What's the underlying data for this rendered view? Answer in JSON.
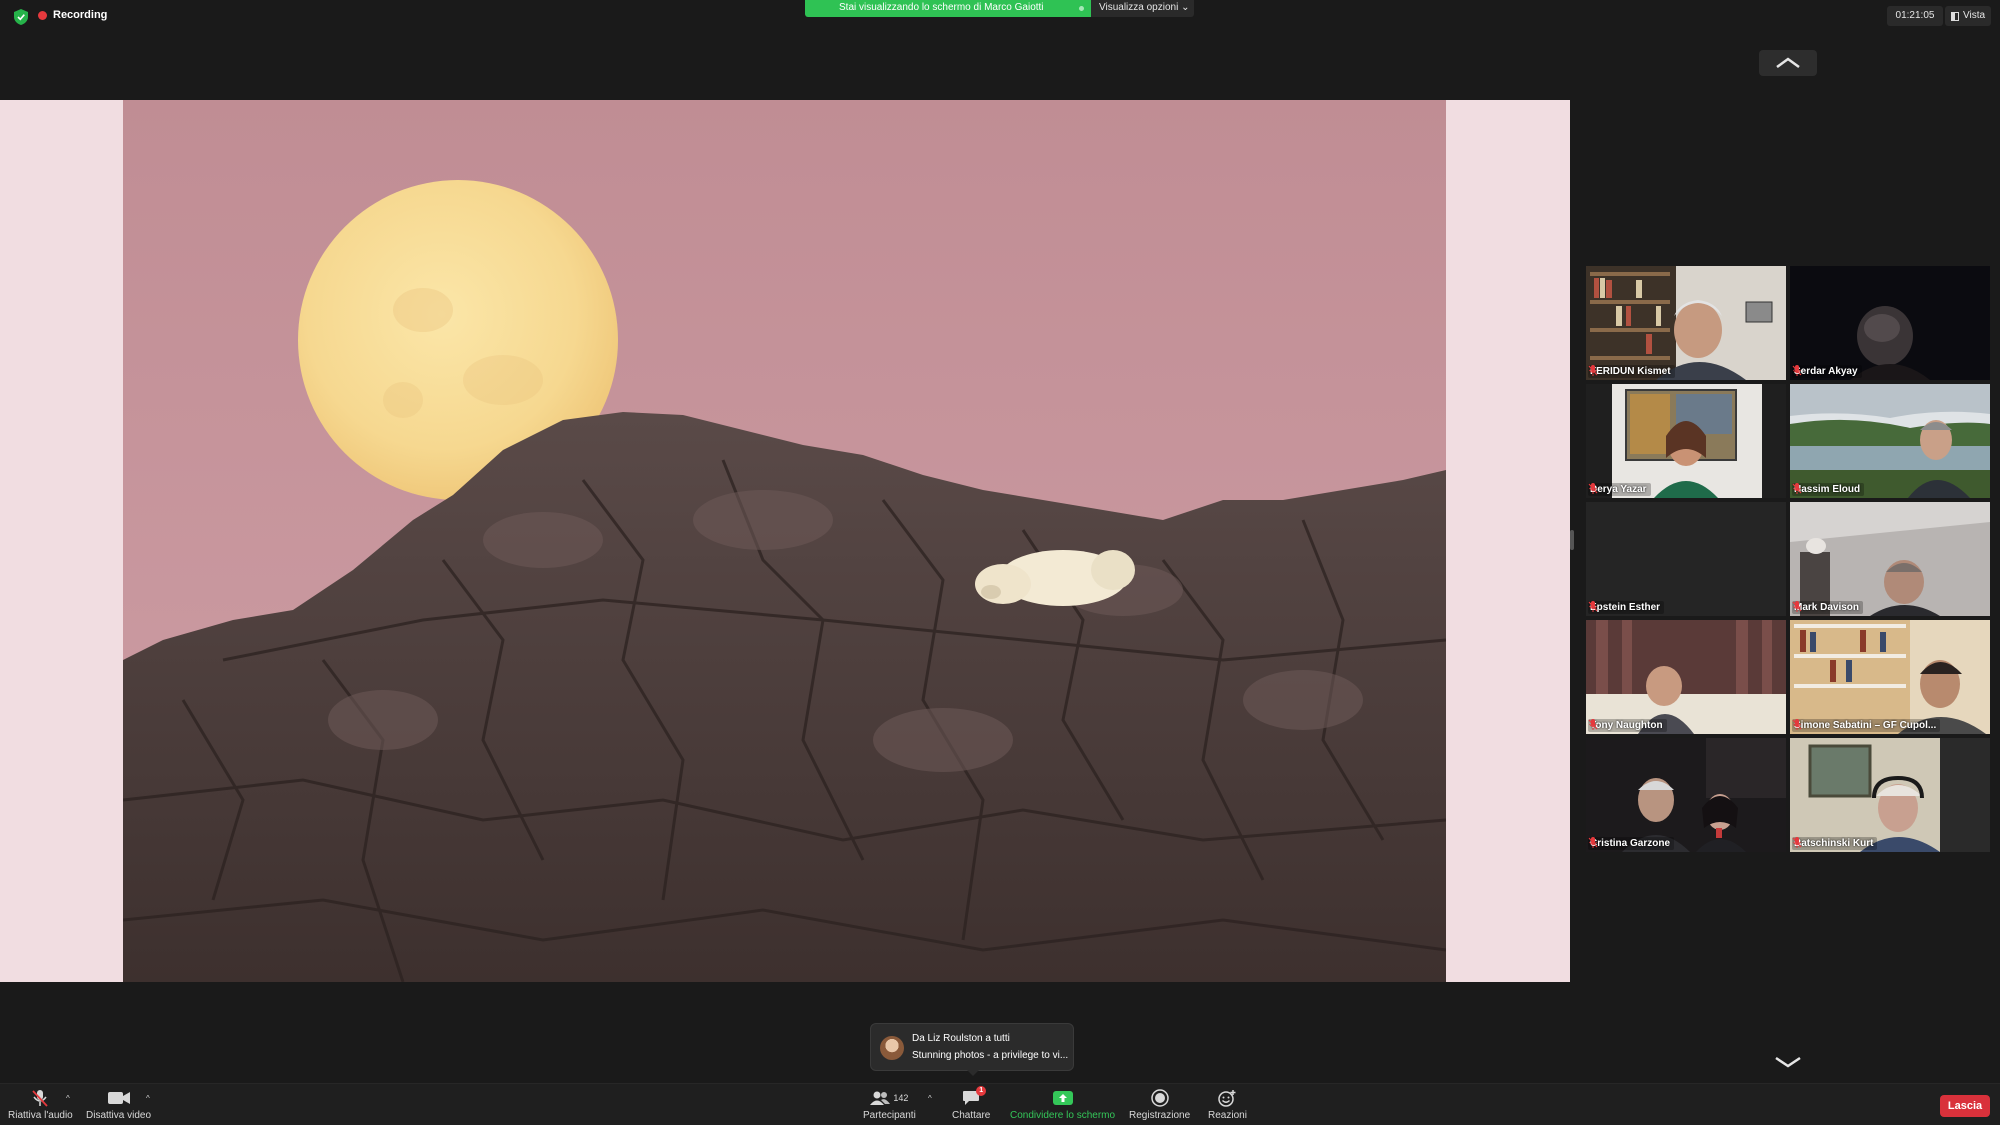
{
  "topbar": {
    "recording_label": "Recording",
    "share_banner": "Stai visualizzando lo schermo di Marco Gaiotti",
    "view_options": "Visualizza opzioni ⌄",
    "timer": "01:21:05",
    "view_label": "Vista"
  },
  "participants": [
    {
      "name": "FERIDUN Kismet"
    },
    {
      "name": "Serdar Akyay"
    },
    {
      "name": "Derya Yazar"
    },
    {
      "name": "Nassim Eloud"
    },
    {
      "name": "Epstein Esther"
    },
    {
      "name": "Mark Davison"
    },
    {
      "name": "Tony Naughton"
    },
    {
      "name": "Simone Sabatini – GF Cupol..."
    },
    {
      "name": "Cristina Garzone"
    },
    {
      "name": "Batschinski Kurt"
    }
  ],
  "chat_toast": {
    "from": "Da Liz Roulston a tutti",
    "message": "Stunning photos - a privilege to vi..."
  },
  "toolbar": {
    "audio_label": "Riattiva l'audio",
    "video_label": "Disattiva video",
    "participants_label": "Partecipanti",
    "participants_count": "142",
    "chat_label": "Chattare",
    "chat_badge": "1",
    "share_label": "Condividere lo schermo",
    "record_label": "Registrazione",
    "reactions_label": "Reazioni",
    "leave_label": "Lascia"
  },
  "colors": {
    "share_green": "#2fc254",
    "leave_red": "#d9313b",
    "muted_red": "#e5393d"
  }
}
